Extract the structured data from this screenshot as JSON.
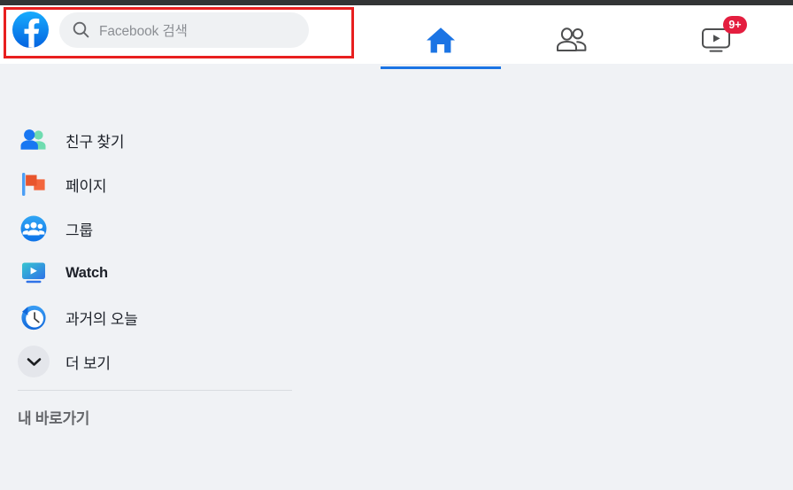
{
  "app": {
    "name": "Facebook",
    "accent_color": "#1b74e4",
    "header_bg": "#ffffff",
    "page_bg": "#f0f2f5",
    "highlight_color": "#e81f1f"
  },
  "header": {
    "logo_name": "facebook-logo",
    "search": {
      "icon": "search-icon",
      "placeholder": "Facebook 검색",
      "value": ""
    },
    "tabs": [
      {
        "id": "home",
        "icon": "home-icon",
        "label": "홈",
        "active": true,
        "badge": ""
      },
      {
        "id": "friends",
        "icon": "friends-icon",
        "label": "친구",
        "active": false,
        "badge": ""
      },
      {
        "id": "watch",
        "icon": "watch-icon",
        "label": "Watch",
        "active": false,
        "badge": "9+"
      }
    ]
  },
  "sidebar": {
    "items": [
      {
        "id": "find-friends",
        "icon": "friends-color-icon",
        "label": "친구 찾기",
        "bold": false
      },
      {
        "id": "pages",
        "icon": "flag-icon",
        "label": "페이지",
        "bold": false
      },
      {
        "id": "groups",
        "icon": "groups-icon",
        "label": "그룹",
        "bold": false
      },
      {
        "id": "watch",
        "icon": "watch-color-icon",
        "label": "Watch",
        "bold": true
      },
      {
        "id": "memories",
        "icon": "clock-icon",
        "label": "과거의 오늘",
        "bold": false
      },
      {
        "id": "see-more",
        "icon": "chevron-down-icon",
        "label": "더 보기",
        "bold": false
      }
    ],
    "shortcuts_title": "내 바로가기"
  }
}
